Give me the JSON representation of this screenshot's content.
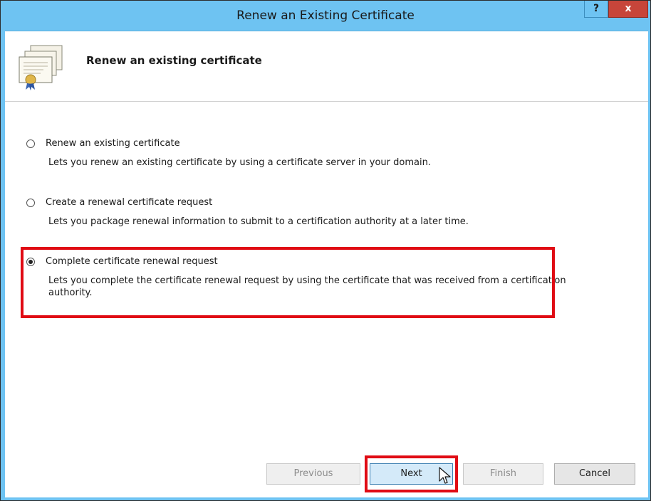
{
  "window": {
    "title": "Renew an Existing Certificate",
    "help_label": "?",
    "close_label": "x"
  },
  "header": {
    "title": "Renew an existing certificate",
    "icon": "certificate-icon"
  },
  "options": [
    {
      "label": "Renew an existing certificate",
      "description": "Lets you renew an existing certificate by using a certificate server in your domain.",
      "selected": false
    },
    {
      "label": "Create a renewal certificate request",
      "description": "Lets you package renewal information to submit to a certification authority at a later time.",
      "selected": false
    },
    {
      "label": "Complete certificate renewal request",
      "description": "Lets you complete the certificate renewal request by using the certificate that was received from a certification authority.",
      "selected": true
    }
  ],
  "buttons": {
    "previous": "Previous",
    "next": "Next",
    "finish": "Finish",
    "cancel": "Cancel"
  },
  "colors": {
    "titlebar": "#6ec3f2",
    "close": "#c7453a",
    "highlight": "#e00b14"
  }
}
